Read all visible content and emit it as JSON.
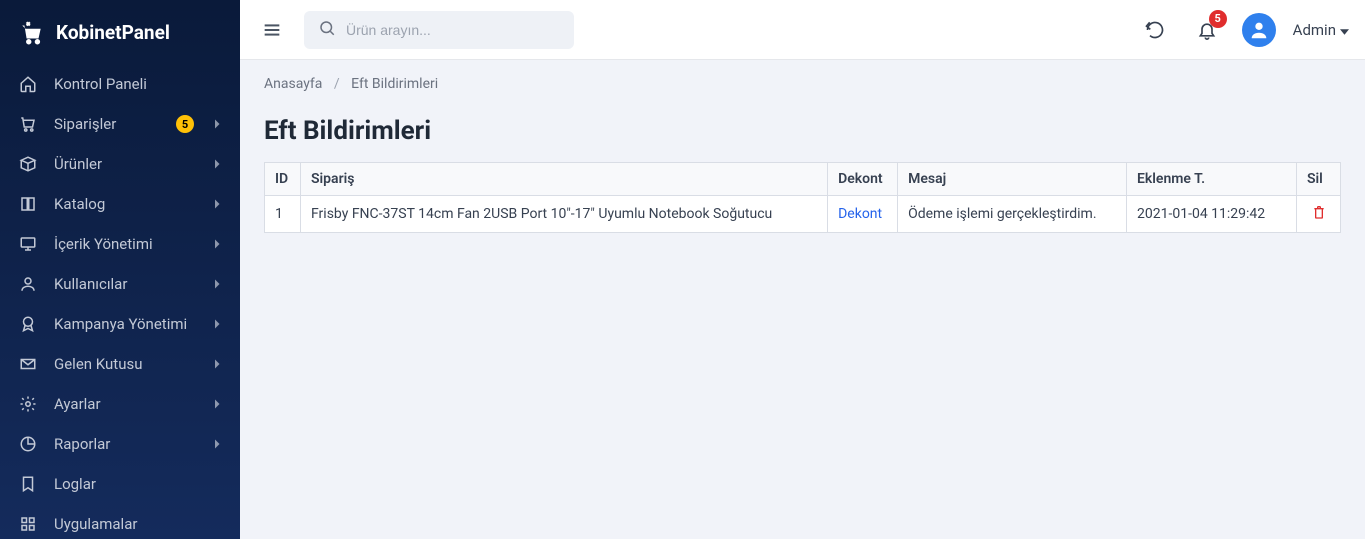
{
  "brand": "KobinetPanel",
  "search": {
    "placeholder": "Ürün arayın..."
  },
  "notifications": {
    "count": "5"
  },
  "user": {
    "name": "Admin"
  },
  "sidebar": {
    "items": [
      {
        "label": "Kontrol Paneli",
        "icon": "home",
        "expandable": false
      },
      {
        "label": "Siparişler",
        "icon": "cart",
        "expandable": true,
        "badge": "5"
      },
      {
        "label": "Ürünler",
        "icon": "box",
        "expandable": true
      },
      {
        "label": "Katalog",
        "icon": "book",
        "expandable": true
      },
      {
        "label": "İçerik Yönetimi",
        "icon": "monitor",
        "expandable": true
      },
      {
        "label": "Kullanıcılar",
        "icon": "users",
        "expandable": true
      },
      {
        "label": "Kampanya Yönetimi",
        "icon": "ribbon",
        "expandable": true
      },
      {
        "label": "Gelen Kutusu",
        "icon": "inbox",
        "expandable": true
      },
      {
        "label": "Ayarlar",
        "icon": "gear",
        "expandable": true
      },
      {
        "label": "Raporlar",
        "icon": "chart",
        "expandable": true
      },
      {
        "label": "Loglar",
        "icon": "bookmark",
        "expandable": false
      },
      {
        "label": "Uygulamalar",
        "icon": "apps",
        "expandable": false
      }
    ]
  },
  "breadcrumb": {
    "home": "Anasayfa",
    "current": "Eft Bildirimleri"
  },
  "page": {
    "title": "Eft Bildirimleri"
  },
  "table": {
    "headers": {
      "id": "ID",
      "siparis": "Sipariş",
      "dekont": "Dekont",
      "mesaj": "Mesaj",
      "eklenme": "Eklenme T.",
      "sil": "Sil"
    },
    "rows": [
      {
        "id": "1",
        "siparis": "Frisby FNC-37ST 14cm Fan 2USB Port 10\"-17\" Uyumlu Notebook Soğutucu",
        "dekont": "Dekont",
        "mesaj": "Ödeme işlemi gerçekleştirdim.",
        "eklenme": "2021-01-04 11:29:42"
      }
    ]
  }
}
